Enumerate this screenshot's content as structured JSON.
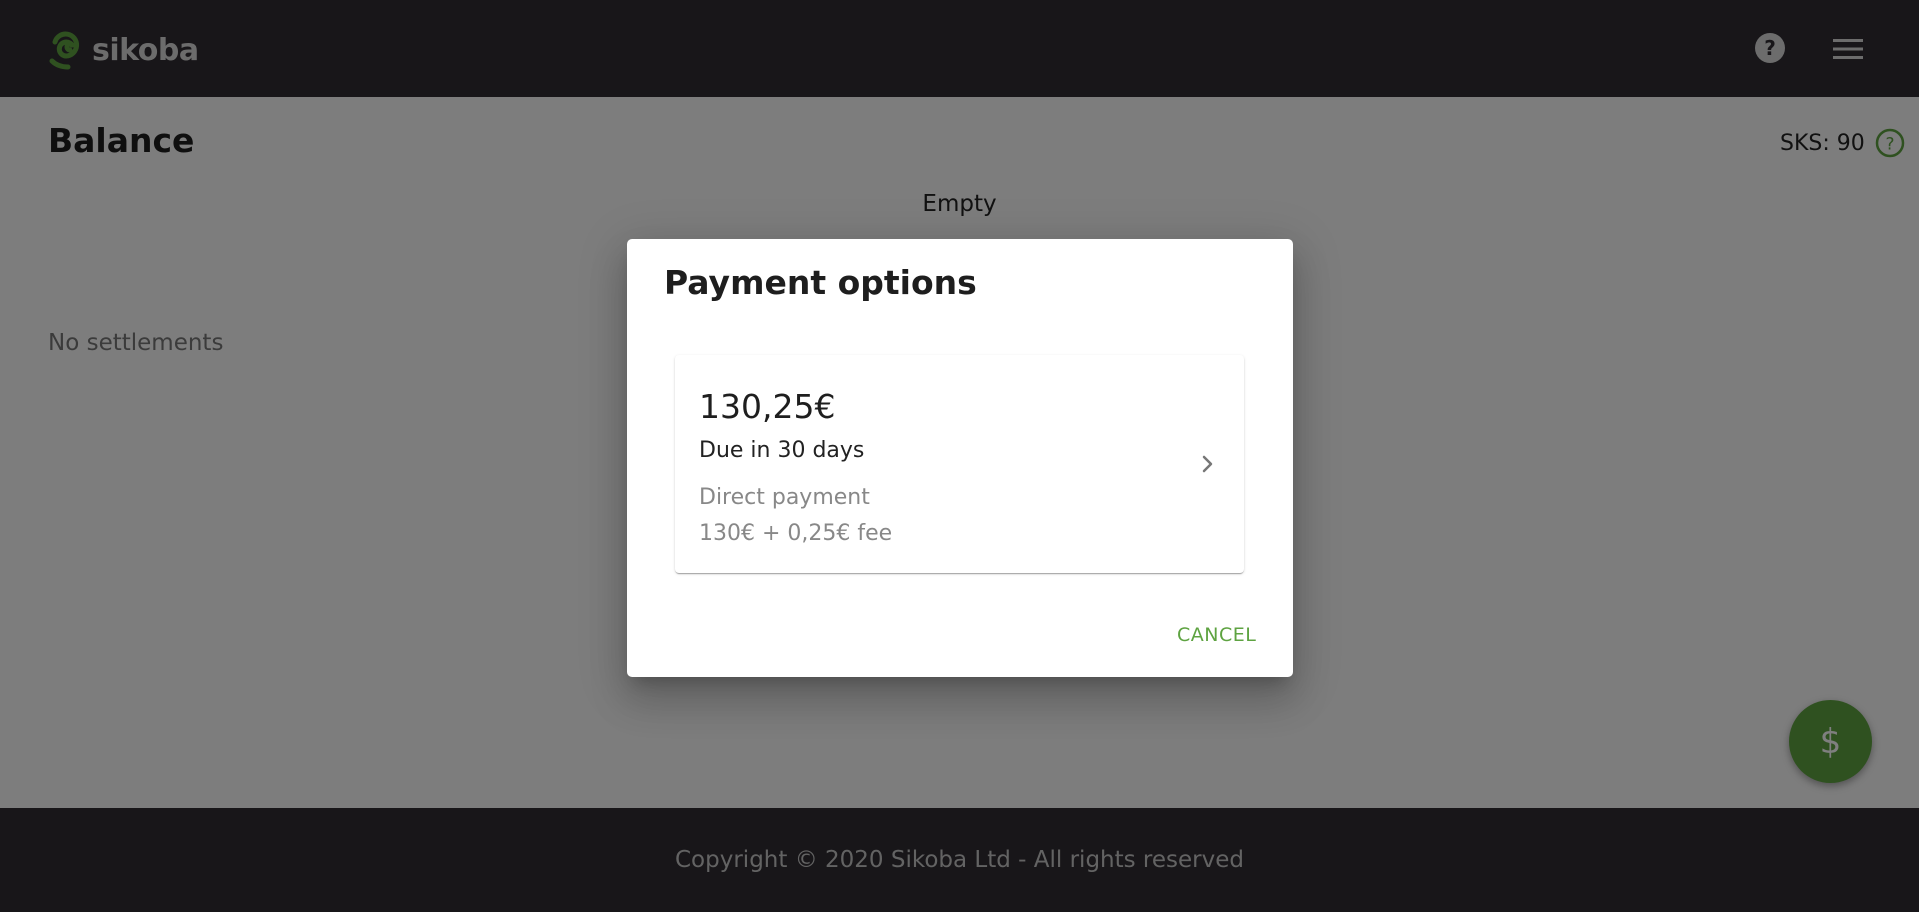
{
  "header": {
    "logo_text": "sikoba",
    "help_icon": "help-circle-icon",
    "menu_icon": "hamburger-menu-icon"
  },
  "page": {
    "title": "Balance",
    "sks_label": "SKS: 90",
    "sks_help_icon": "help-circle-outline-icon",
    "empty_text": "Empty",
    "no_settlements": "No settlements"
  },
  "fab": {
    "label": "$"
  },
  "footer": {
    "copyright": "Copyright © 2020 Sikoba Ltd - All rights reserved"
  },
  "dialog": {
    "title": "Payment options",
    "option": {
      "amount": "130,25€",
      "due": "Due in 30 days",
      "method": "Direct payment",
      "fee": "130€ + 0,25€ fee",
      "chevron_icon": "chevron-right-icon"
    },
    "cancel_label": "CANCEL"
  },
  "colors": {
    "header_bg": "#302c33",
    "accent": "#5ea341",
    "overlay": "rgba(0,0,0,0.5)"
  }
}
